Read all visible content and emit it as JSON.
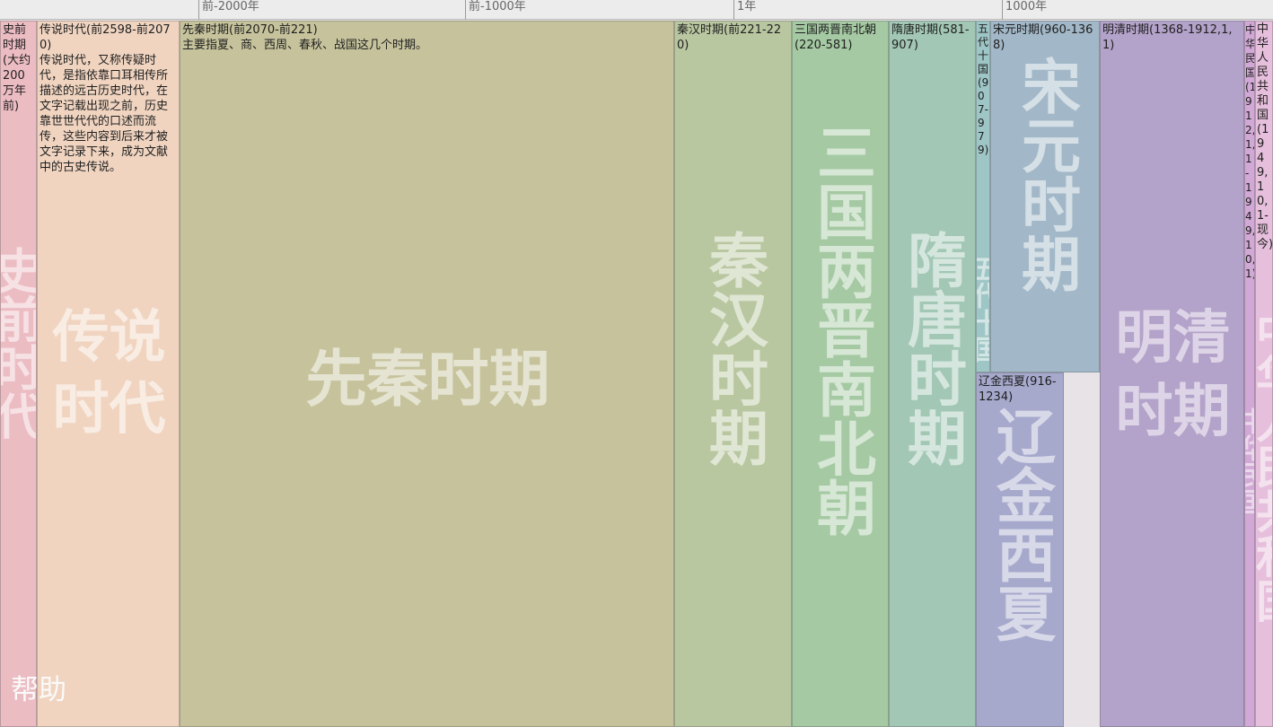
{
  "axis_ticks": [
    {
      "label": "前-2000年"
    },
    {
      "label": "前-1000年"
    },
    {
      "label": "1年"
    },
    {
      "label": "1000年"
    }
  ],
  "periods": [
    {
      "key": "prehistory",
      "title": "史前时期(大约200万年前)",
      "big": "史前时代",
      "color": "#ecbcc3"
    },
    {
      "key": "legend",
      "title": "传说时代(前2598-前2070)",
      "desc": "传说时代，又称传疑时代，是指依靠口耳相传所描述的远古历史时代，在文字记载出现之前，历史靠世世代代的口述而流传，这些内容到后来才被文字记录下来，成为文献中的古史传说。",
      "big": "传说时代",
      "color": "#f0d4c0"
    },
    {
      "key": "preqin",
      "title": "先秦时期(前2070-前221)",
      "desc": "主要指夏、商、西周、春秋、战国这几个时期。",
      "big": "先秦时期",
      "color": "#c6c39c"
    },
    {
      "key": "qinhan",
      "title": "秦汉时期(前221-220)",
      "big": "秦汉时期",
      "color": "#b9c7a1"
    },
    {
      "key": "sanguo",
      "title": "三国两晋南北朝(220-581)",
      "big": "三国两晋南北朝",
      "color": "#a5c9a2"
    },
    {
      "key": "suitang",
      "title": "隋唐时期(581-907)",
      "big": "隋唐时期",
      "color": "#a2c7b5"
    },
    {
      "key": "wudai",
      "title": "五代十国(907-979)",
      "big": "五代十国",
      "color": "#9fc6c6"
    },
    {
      "key": "songyuan",
      "title": "宋元时期(960-1368)",
      "big": "宋元时期",
      "color": "#a2b8c8"
    },
    {
      "key": "liaojin",
      "title": "辽金西夏(916-1234)",
      "big": "辽金西夏",
      "color": "#a6a9cc"
    },
    {
      "key": "mingqing",
      "title": "明清时期(1368-1912,1,1)",
      "big": "明清时期",
      "color": "#b3a2c9"
    },
    {
      "key": "minguo",
      "title": "中华民国(1912,1,1-1949,10,1)",
      "big": "中华民国",
      "color": "#d2a9d6"
    },
    {
      "key": "prc",
      "title": "中华人民共和国(1949,10,1-现今)",
      "big": "中华人民共和国",
      "color": "#e6bfdc"
    }
  ],
  "help_label": "帮助"
}
